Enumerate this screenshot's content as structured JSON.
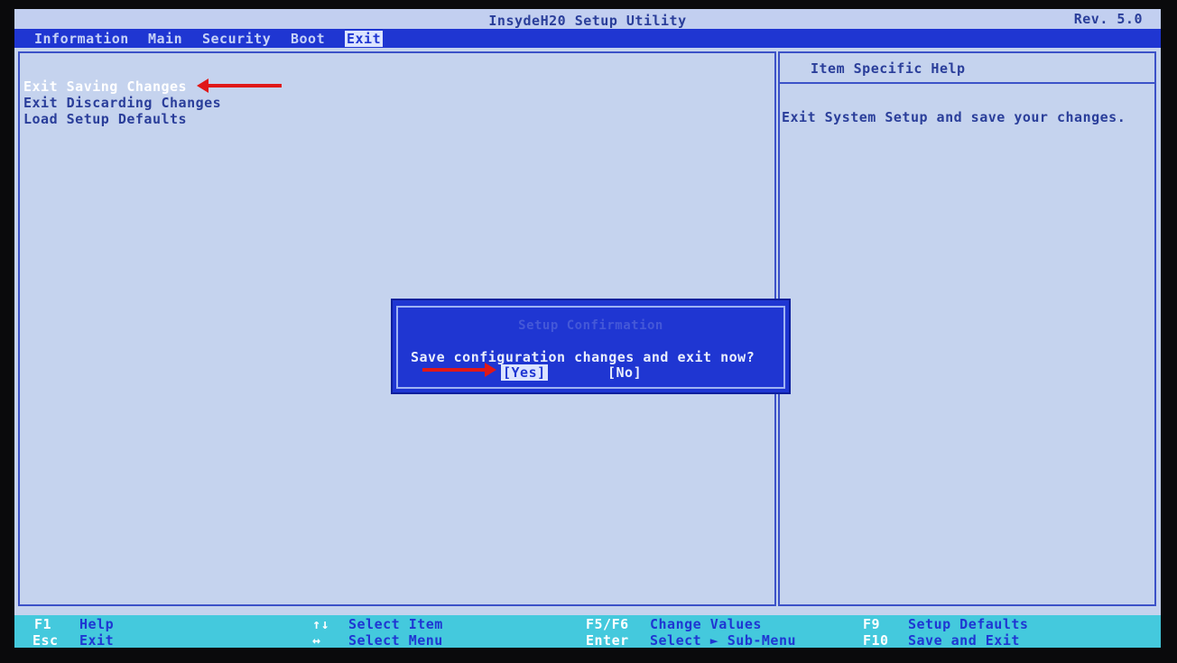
{
  "title": "InsydeH20 Setup Utility",
  "revision": "Rev. 5.0",
  "menu": [
    "Information",
    "Main",
    "Security",
    "Boot",
    "Exit"
  ],
  "menu_active": "Exit",
  "options": [
    "Exit Saving Changes",
    "Exit Discarding Changes",
    "Load Setup Defaults"
  ],
  "help": {
    "title": "Item Specific Help",
    "text": "Exit System Setup and save your changes."
  },
  "dialog": {
    "title": "Setup Confirmation",
    "message": "Save configuration changes and exit now?",
    "yes": "[Yes]",
    "no": "[No]"
  },
  "footer": [
    {
      "key": "F1",
      "desc": "Help"
    },
    {
      "key": "Esc",
      "desc": "Exit"
    },
    {
      "key": "↑↓",
      "desc": "Select Item"
    },
    {
      "key": "↔",
      "desc": "Select Menu"
    },
    {
      "key": "F5/F6",
      "desc": "Change Values"
    },
    {
      "key": "Enter",
      "desc": "Select ► Sub-Menu"
    },
    {
      "key": "F9",
      "desc": "Setup Defaults"
    },
    {
      "key": "F10",
      "desc": "Save and Exit"
    }
  ],
  "colors": {
    "menubar": "#1f36d2",
    "background": "#c5d3ee",
    "footer": "#44c9dd",
    "annotation_arrow": "#e01818"
  }
}
